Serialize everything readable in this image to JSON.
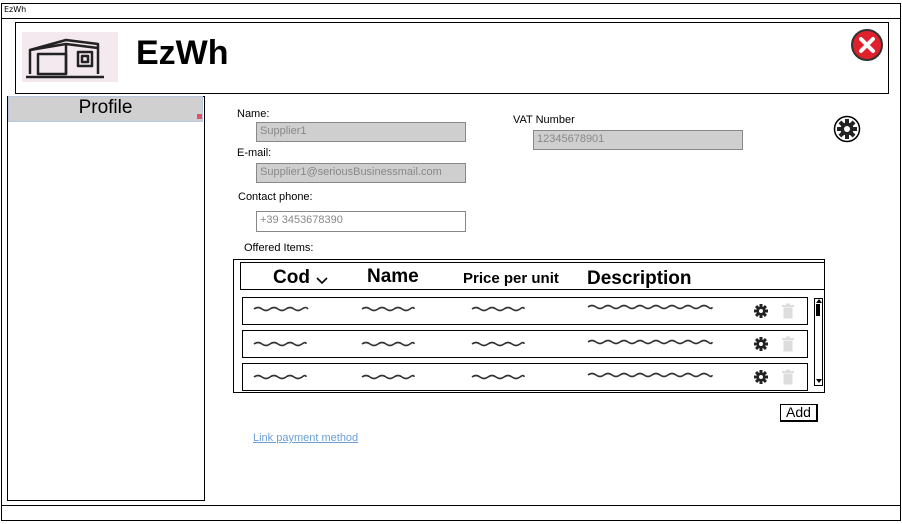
{
  "window": {
    "title": "EzWh"
  },
  "header": {
    "app_name": "EzWh",
    "logo_icon": "warehouse-icon",
    "close_icon": "close-icon",
    "close_color": "#e0202a"
  },
  "sidebar": {
    "items": [
      {
        "label": "Profile",
        "selected": true
      }
    ]
  },
  "form": {
    "name": {
      "label": "Name:",
      "placeholder": "Supplier1"
    },
    "email": {
      "label": "E-mail:",
      "placeholder": "Supplier1@seriousBusinessmail.com"
    },
    "phone": {
      "label": "Contact phone:",
      "placeholder": "+39 3453678390"
    },
    "vat": {
      "label": "VAT Number",
      "placeholder": "12345678901"
    },
    "settings_icon": "gear-icon"
  },
  "items_table": {
    "label": "Offered Items:",
    "columns": [
      "Cod",
      "Name",
      "Price per unit",
      "Description"
    ],
    "sort_icon": "chevron-down-icon",
    "row_count": 3,
    "row_icons": [
      "gear-icon",
      "trash-icon"
    ]
  },
  "actions": {
    "add_label": "Add",
    "link_payment_label": "Link payment method"
  }
}
